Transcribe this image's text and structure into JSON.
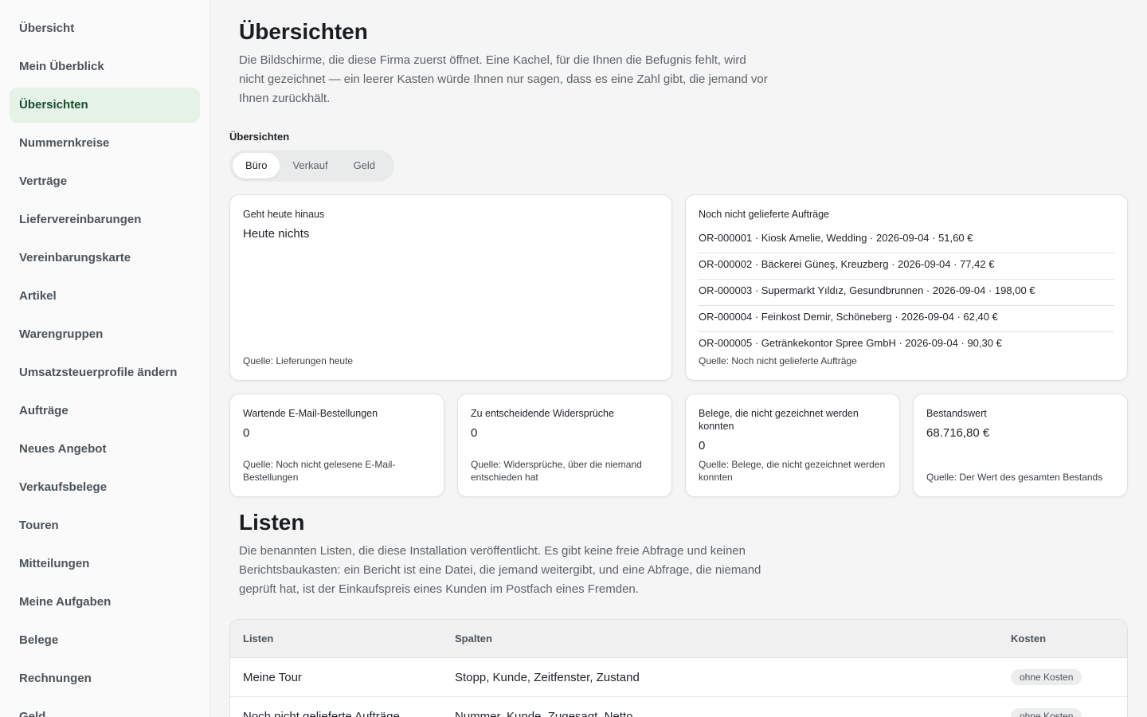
{
  "sidebar": {
    "items": [
      {
        "label": "Übersicht",
        "active": false
      },
      {
        "label": "Mein Überblick",
        "active": false
      },
      {
        "label": "Übersichten",
        "active": true
      },
      {
        "label": "Nummernkreise",
        "active": false
      },
      {
        "label": "Verträge",
        "active": false
      },
      {
        "label": "Liefervereinbarungen",
        "active": false
      },
      {
        "label": "Vereinbarungskarte",
        "active": false
      },
      {
        "label": "Artikel",
        "active": false
      },
      {
        "label": "Warengruppen",
        "active": false
      },
      {
        "label": "Umsatzsteuerprofile ändern",
        "active": false
      },
      {
        "label": "Aufträge",
        "active": false
      },
      {
        "label": "Neues Angebot",
        "active": false
      },
      {
        "label": "Verkaufsbelege",
        "active": false
      },
      {
        "label": "Touren",
        "active": false
      },
      {
        "label": "Mitteilungen",
        "active": false
      },
      {
        "label": "Meine Aufgaben",
        "active": false
      },
      {
        "label": "Belege",
        "active": false
      },
      {
        "label": "Rechnungen",
        "active": false
      },
      {
        "label": "Geld",
        "active": false
      }
    ]
  },
  "overview": {
    "title": "Übersichten",
    "description": "Die Bildschirme, die diese Firma zuerst öffnet. Eine Kachel, für die Ihnen die Befugnis fehlt, wird nicht gezeichnet — ein leerer Kasten würde Ihnen nur sagen, dass es eine Zahl gibt, die jemand vor Ihnen zurückhält.",
    "group_label": "Übersichten",
    "tabs": [
      {
        "label": "Büro",
        "active": true
      },
      {
        "label": "Verkauf",
        "active": false
      },
      {
        "label": "Geld",
        "active": false
      }
    ]
  },
  "cards": {
    "today": {
      "title": "Geht heute hinaus",
      "value": "Heute nichts",
      "source": "Quelle: Lieferungen heute"
    },
    "undelivered": {
      "title": "Noch nicht gelieferte Aufträge",
      "items": [
        "OR-000001 · Kiosk Amelie, Wedding · 2026-09-04 · 51,60 €",
        "OR-000002 · Bäckerei Güneş, Kreuzberg · 2026-09-04 · 77,42 €",
        "OR-000003 · Supermarkt Yıldız, Gesundbrunnen · 2026-09-04 · 198,00 €",
        "OR-000004 · Feinkost Demir, Schöneberg · 2026-09-04 · 62,40 €",
        "OR-000005 · Getränkekontor Spree GmbH · 2026-09-04 · 90,30 €"
      ],
      "source": "Quelle: Noch nicht gelieferte Aufträge"
    },
    "email_orders": {
      "title": "Wartende E-Mail-Bestellungen",
      "value": "0",
      "source": "Quelle: Noch nicht gelesene E-Mail-Bestellungen"
    },
    "disputes": {
      "title": "Zu entscheidende Widersprüche",
      "value": "0",
      "source": "Quelle: Widersprüche, über die niemand entschieden hat"
    },
    "unsigned": {
      "title": "Belege, die nicht gezeichnet werden konnten",
      "value": "0",
      "source": "Quelle: Belege, die nicht gezeichnet werden konnten"
    },
    "stock_value": {
      "title": "Bestandswert",
      "value": "68.716,80 €",
      "source": "Quelle: Der Wert des gesamten Bestands"
    }
  },
  "lists": {
    "title": "Listen",
    "description": "Die benannten Listen, die diese Installation veröffentlicht. Es gibt keine freie Abfrage und keinen Berichtsbaukasten: ein Bericht ist eine Datei, die jemand weitergibt, und eine Abfrage, die niemand geprüft hat, ist der Einkaufspreis eines Kunden im Postfach eines Fremden.",
    "columns": [
      "Listen",
      "Spalten",
      "Kosten"
    ],
    "rows": [
      {
        "name": "Meine Tour",
        "columns": "Stopp, Kunde, Zeitfenster, Zustand",
        "cost": "ohne Kosten"
      },
      {
        "name": "Noch nicht gelieferte Aufträge",
        "columns": "Nummer, Kunde, Zugesagt, Netto",
        "cost": "ohne Kosten"
      }
    ]
  }
}
